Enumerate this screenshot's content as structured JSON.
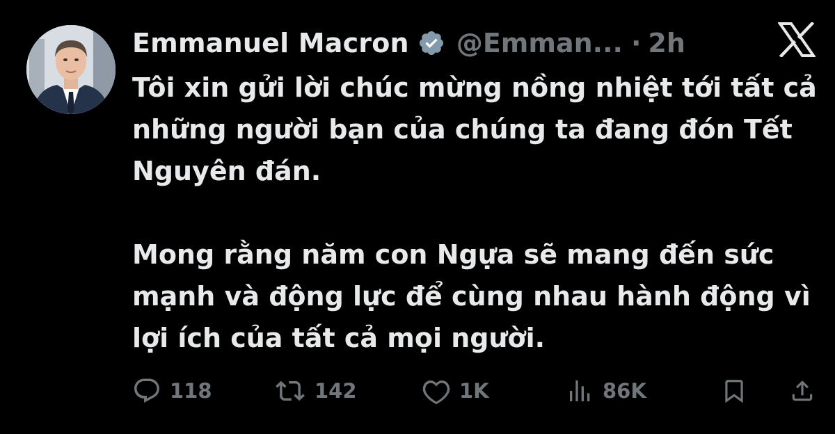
{
  "author": {
    "display_name": "Emmanuel Macron",
    "handle": "@Emman...",
    "separator": "·",
    "time": "2h",
    "verified_icon": "verified-badge-icon",
    "avatar": "profile-photo"
  },
  "tweet": {
    "paragraphs": [
      "Tôi xin gửi lời chúc mừng nồng nhiệt tới tất cả những người bạn của chúng ta đang đón Tết Nguyên đán.",
      "Mong rằng năm con Ngựa sẽ mang đến sức mạnh và động lực để cùng nhau hành động vì lợi ích của tất cả mọi người."
    ]
  },
  "actions": {
    "reply": {
      "icon": "reply-icon",
      "count": "118"
    },
    "repost": {
      "icon": "repost-icon",
      "count": "142"
    },
    "like": {
      "icon": "heart-icon",
      "count": "1K"
    },
    "views": {
      "icon": "views-icon",
      "count": "86K"
    },
    "bookmark": {
      "icon": "bookmark-icon"
    },
    "share": {
      "icon": "share-icon"
    }
  },
  "brand": {
    "logo": "x-logo-icon"
  },
  "colors": {
    "background": "#000000",
    "text_primary": "#e7e9ea",
    "text_secondary": "#71767b"
  }
}
